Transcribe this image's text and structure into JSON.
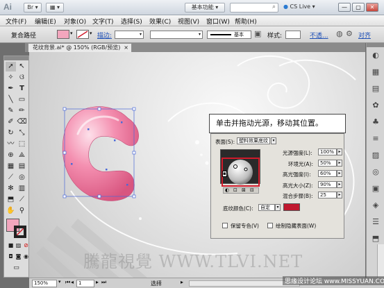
{
  "titlebar": {
    "app_icon": "Ai",
    "workspace": "基本功能",
    "cs_live": "CS Live",
    "search_placeholder": ""
  },
  "menu": [
    "文件(F)",
    "编辑(E)",
    "对象(O)",
    "文字(T)",
    "选择(S)",
    "效果(C)",
    "视图(V)",
    "窗口(W)",
    "帮助(H)"
  ],
  "control_bar": {
    "label": "复合路径",
    "stroke_label": "描边:",
    "stroke_style": "基本",
    "style_label": "样式:",
    "opacity_label": "不透...",
    "more_label": "对齐",
    "fill_color": "#f2a6bd"
  },
  "document": {
    "tab": "花纹背景.ai* @ 150% (RGB/预览)"
  },
  "callout": {
    "text": "单击并拖动光源，移动其位置。"
  },
  "dialog": {
    "surface_label": "表面(S):",
    "surface_value": "塑料效果底纹",
    "params": [
      {
        "label": "光源强度(L):",
        "value": "100%"
      },
      {
        "label": "环境光(A):",
        "value": "50%"
      },
      {
        "label": "高光强度(I):",
        "value": "60%"
      },
      {
        "label": "高光大小(Z):",
        "value": "90%"
      },
      {
        "label": "混合步骤(B):",
        "value": "25"
      }
    ],
    "shading_label": "底纹颜色(C):",
    "shading_value": "自定",
    "shading_color": "#c0182e",
    "preserve_spot": "保留专色(V)",
    "draw_hidden": "绘制隐藏表面(W)"
  },
  "statusbar": {
    "zoom": "150%",
    "page": "1",
    "status": "选择"
  },
  "watermark": "騰龍視覺 WWW.TLVI.NET",
  "site_mark": "思缘设计论坛 www.MISSYUAN.COM",
  "colors": {
    "letter_pink": "#f48fb0",
    "highlight_red": "#d01a2a"
  }
}
